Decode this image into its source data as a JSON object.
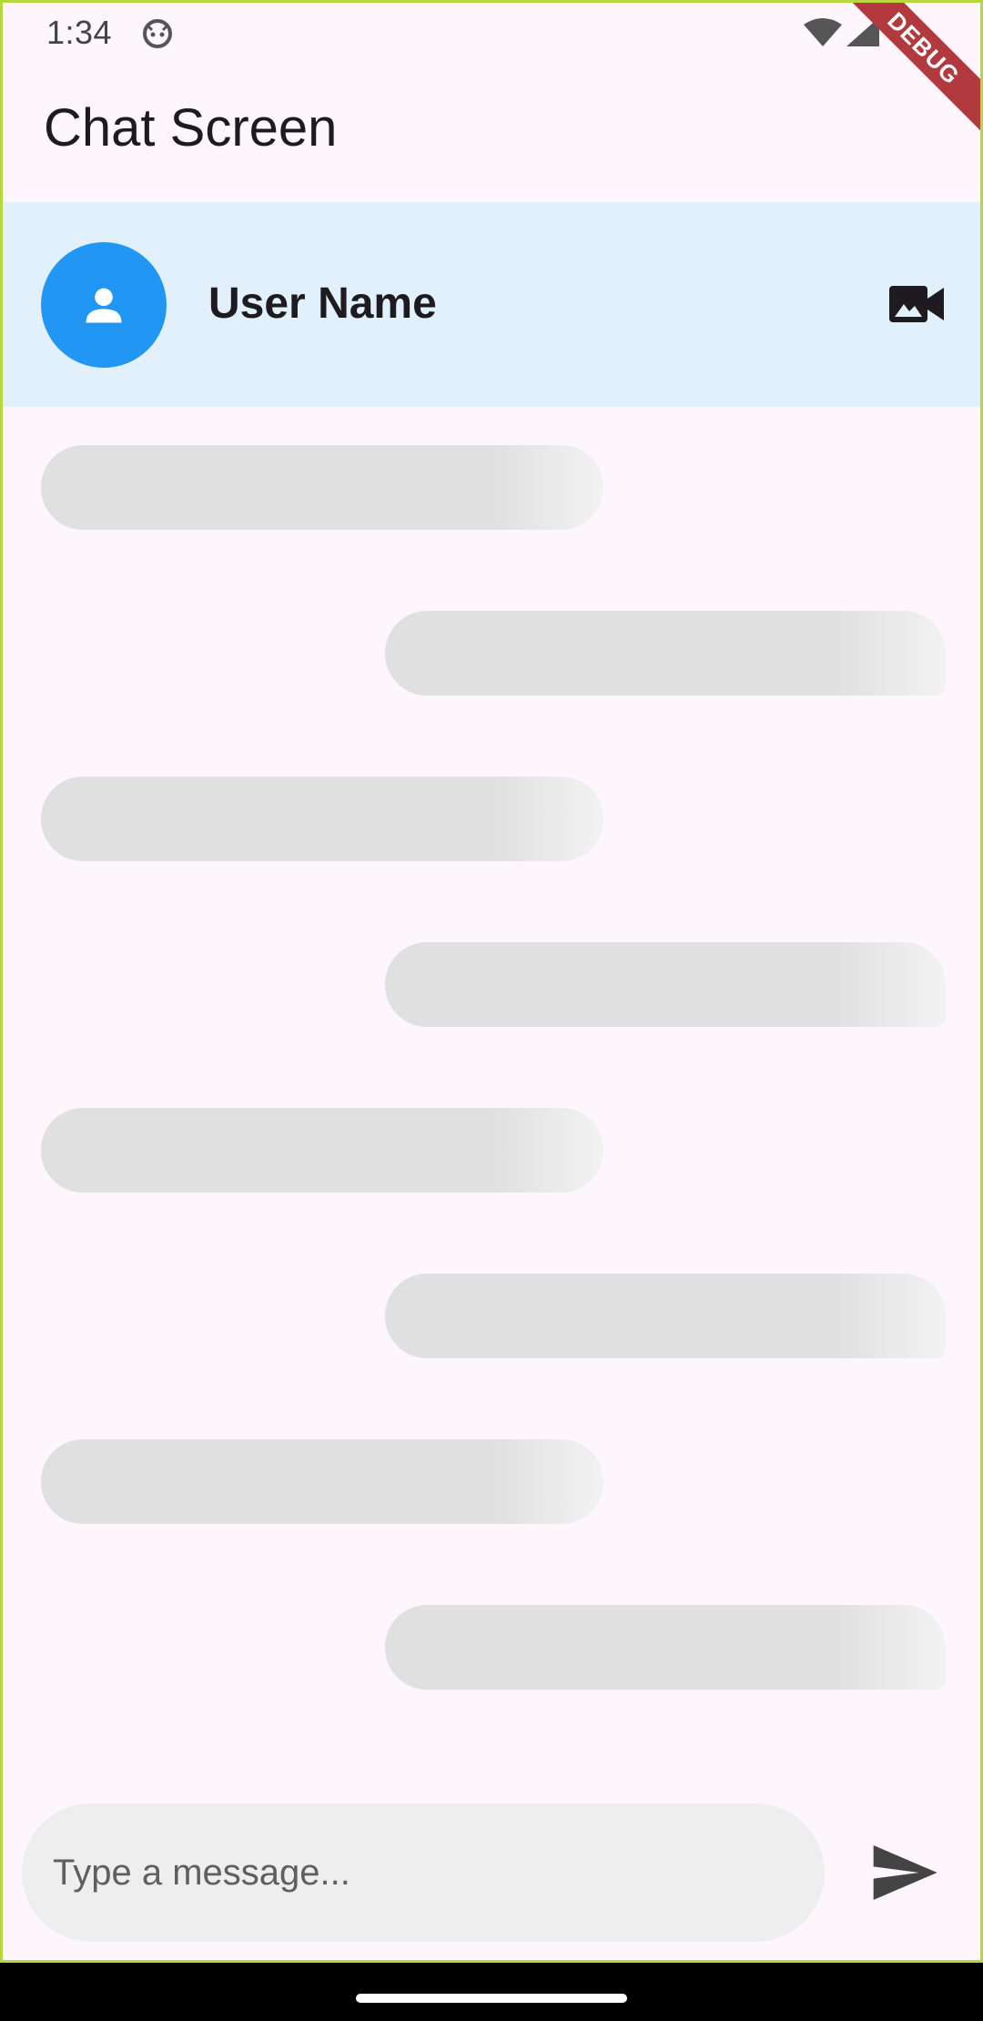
{
  "status_bar": {
    "time": "1:34",
    "icons": [
      "android-icon",
      "wifi-icon",
      "signal-icon"
    ]
  },
  "debug_banner": "DEBUG",
  "app_bar": {
    "title": "Chat Screen"
  },
  "chat_header": {
    "user_name": "User Name",
    "avatar_icon": "person-icon",
    "action_icon": "video-call-icon",
    "avatar_color": "#2196f3",
    "background_color": "#e2f0fb"
  },
  "messages": {
    "state": "loading-placeholders",
    "placeholders": [
      {
        "side": "left"
      },
      {
        "side": "right"
      },
      {
        "side": "left"
      },
      {
        "side": "right"
      },
      {
        "side": "left"
      },
      {
        "side": "right"
      },
      {
        "side": "left"
      },
      {
        "side": "right"
      }
    ]
  },
  "composer": {
    "placeholder": "Type a message...",
    "value": "",
    "send_icon": "send-icon"
  }
}
